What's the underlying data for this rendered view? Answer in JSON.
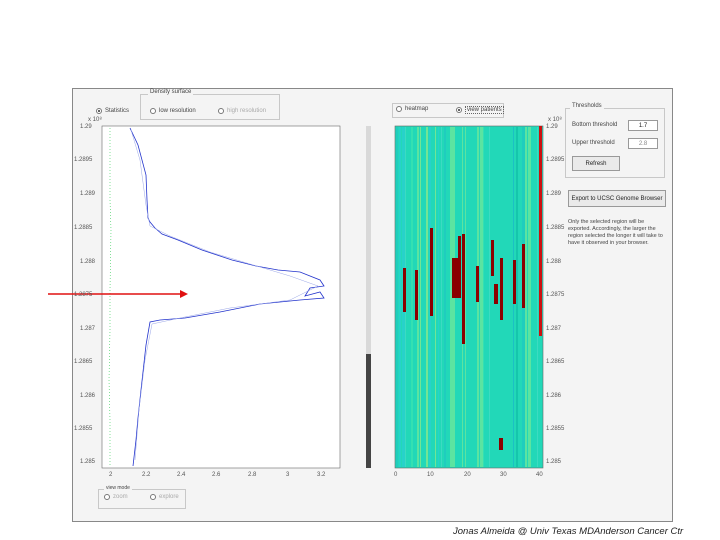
{
  "density_panel": {
    "title": "Density surface",
    "options": [
      {
        "label": "Statistics",
        "selected": true
      },
      {
        "label": "low resolution",
        "selected": false
      },
      {
        "label": "high resolution",
        "selected": false
      }
    ]
  },
  "view_panel": {
    "options": [
      {
        "label": "heatmap",
        "selected": false
      },
      {
        "label": "view patients",
        "selected": true
      }
    ]
  },
  "thresholds": {
    "title": "Thresholds",
    "bottom_label": "Bottom threshold",
    "bottom_value": "1.7",
    "upper_label": "Upper threshold",
    "upper_value": "2.8",
    "refresh_label": "Refresh"
  },
  "export_button_label": "Export to UCSC Genome Browser",
  "export_note": "Only the selected region will be exported. Accordingly, the larger the region selected the longer it will take to have it observed in your browser.",
  "view_mode": {
    "title": "view mode",
    "options": [
      {
        "label": "zoom",
        "selected": false
      },
      {
        "label": "explore",
        "selected": false
      }
    ]
  },
  "y_axis": {
    "exponent": "x 10⁸",
    "ticks": [
      "1.29",
      "1.2895",
      "1.289",
      "1.2885",
      "1.288",
      "1.2875",
      "1.287",
      "1.2865",
      "1.286",
      "1.2855",
      "1.285"
    ]
  },
  "left_x_ticks": [
    "2",
    "2.2",
    "2.4",
    "2.6",
    "2.8",
    "3",
    "3.2"
  ],
  "right_x_ticks": [
    "0",
    "10",
    "20",
    "30",
    "40"
  ],
  "colors": {
    "density_line": "#2233cc",
    "heatmap_bg": "#22d8b8",
    "heatmap_mark": "#8b0000",
    "arrow": "#e01010"
  },
  "footer": "Jonas Almeida @ Univ Texas MDAnderson Cancer Ctr"
}
